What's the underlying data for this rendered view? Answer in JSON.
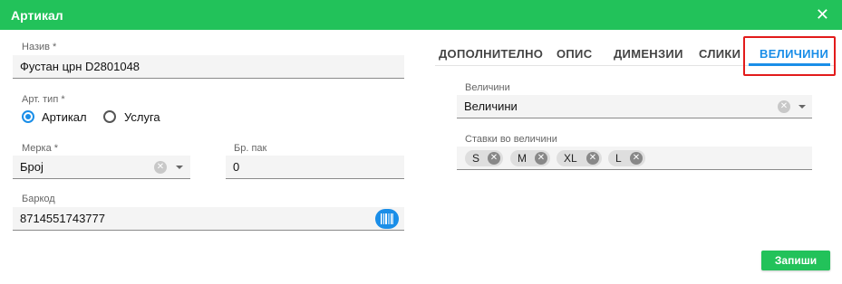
{
  "dialog": {
    "title": "Артикал"
  },
  "form": {
    "name": {
      "label": "Назив *",
      "value": "Фустан црн D2801048"
    },
    "art_type": {
      "label": "Арт. тип *",
      "options": [
        "Артикал",
        "Услуга"
      ],
      "selected": "Артикал"
    },
    "unit": {
      "label": "Мерка *",
      "value": "Број"
    },
    "pack_count": {
      "label": "Бр. пак",
      "value": "0"
    },
    "barcode": {
      "label": "Баркод",
      "value": "8714551743777"
    }
  },
  "tabs": [
    {
      "label": "ДОПОЛНИТЕЛНО",
      "active": false
    },
    {
      "label": "ОПИС",
      "active": false
    },
    {
      "label": "ДИМЕНЗИИ",
      "active": false
    },
    {
      "label": "СЛИКИ",
      "active": false
    },
    {
      "label": "ВЕЛИЧИНИ",
      "active": true
    }
  ],
  "sizes": {
    "label": "Величини",
    "value": "Величини",
    "entries_label": "Ставки во величини",
    "chips": [
      "S",
      "M",
      "XL",
      "L"
    ]
  },
  "actions": {
    "save_label": "Запиши"
  },
  "colors": {
    "header": "#22c25a",
    "accent": "#1a8ee8",
    "highlight": "#e21b1b",
    "save_button": "#22c25a"
  }
}
